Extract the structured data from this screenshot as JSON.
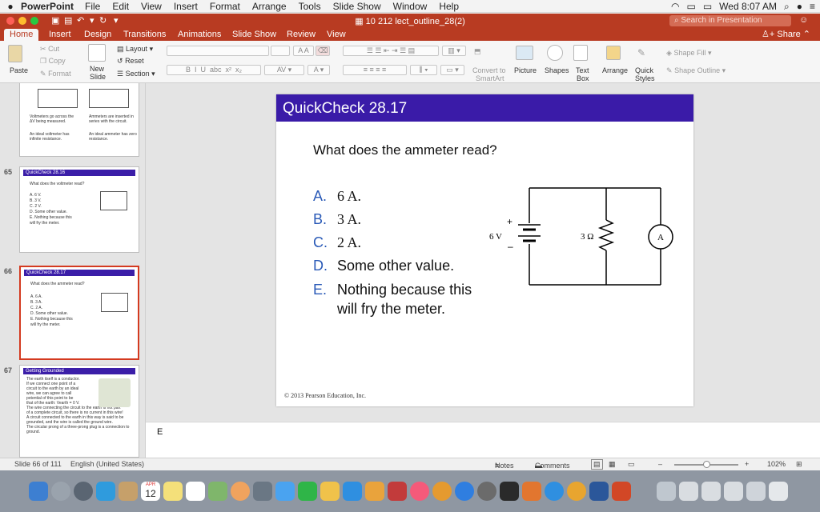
{
  "menubar": {
    "app_name": "PowerPoint",
    "items": [
      "File",
      "Edit",
      "View",
      "Insert",
      "Format",
      "Arrange",
      "Tools",
      "Slide Show",
      "Window",
      "Help"
    ],
    "clock": "Wed 8:07 AM"
  },
  "titlebar": {
    "doc_title": "10 212 lect_outline_28(2)",
    "search_placeholder": "Search in Presentation"
  },
  "ribbon_tabs": {
    "items": [
      "Home",
      "Insert",
      "Design",
      "Transitions",
      "Animations",
      "Slide Show",
      "Review",
      "View"
    ],
    "active": "Home",
    "share_label": "Share"
  },
  "ribbon": {
    "paste": "Paste",
    "cut": "Cut",
    "copy": "Copy",
    "format": "Format",
    "new_slide_1": "New",
    "new_slide_2": "Slide",
    "layout": "Layout",
    "reset": "Reset",
    "section": "Section",
    "convert_1": "Convert to",
    "convert_2": "SmartArt",
    "picture": "Picture",
    "shapes": "Shapes",
    "text_box_1": "Text",
    "text_box_2": "Box",
    "arrange": "Arrange",
    "quick_styles_1": "Quick",
    "quick_styles_2": "Styles",
    "shape_fill": "Shape Fill",
    "shape_outline": "Shape Outline"
  },
  "thumbnails": {
    "top_partial": {
      "bullet_a": "Voltmeters go across the ΔV being measured.",
      "bullet_b": "An ideal voltmeter has infinite resistance.",
      "bullet_c": "Ammeters are inserted in series with the circuit.",
      "bullet_d": "An ideal ammeter has zero resistance."
    },
    "slides": [
      {
        "number": "65",
        "title": "QuickCheck 28.16",
        "question": "What does the voltmeter read?",
        "answers": [
          "A.  6 V.",
          "B.  3 V.",
          "C.  2 V.",
          "D.  Some other value.",
          "E.  Nothing because this",
          "     will fry the meter."
        ]
      },
      {
        "number": "66",
        "title": "QuickCheck 28.17",
        "question": "What does the ammeter read?",
        "answers": [
          "A.  6 A.",
          "B.  3 A.",
          "C.  2 A.",
          "D.  Some other value.",
          "E.  Nothing because this",
          "     will fry the meter."
        ]
      },
      {
        "number": "67",
        "title": "Getting Grounded",
        "bullets": [
          "The earth itself is a conductor.",
          "If we connect one point of a",
          "circuit to the earth by an ideal",
          "wire, we can agree to call",
          "potential of this point to be",
          "that of the earth: Vearth = 0 V.",
          "The wire connecting the circuit to the earth is not part",
          "of a complete circuit, so there is no current in this wire!",
          "A circuit connected to the earth in this way is said to be",
          "grounded, and the wire is called the ground wire.",
          "The circular prong of a three-prong plug is a connection to",
          "ground."
        ]
      }
    ]
  },
  "slide": {
    "title": "QuickCheck 28.17",
    "question": "What does the ammeter read?",
    "answers": [
      {
        "letter": "A.",
        "text": "6 A."
      },
      {
        "letter": "B.",
        "text": "3 A."
      },
      {
        "letter": "C.",
        "text": "2 A."
      },
      {
        "letter": "D.",
        "text": "Some other value."
      },
      {
        "letter": "E.",
        "text": "Nothing because this"
      }
    ],
    "answer_e_line2": "will fry the meter.",
    "circuit": {
      "battery_label": "6 V",
      "plus": "+",
      "minus": "–",
      "resistor_label": "3 Ω",
      "meter_label": "A"
    },
    "copyright": "© 2013 Pearson Education, Inc."
  },
  "notes": {
    "text": "E"
  },
  "statusbar": {
    "slide_indicator": "Slide 66 of 111",
    "language": "English (United States)",
    "notes_label": "Notes",
    "comments_label": "Comments",
    "zoom_minus": "–",
    "zoom_plus": "+",
    "zoom_level": "102%",
    "zoom_fraction": 0.5
  },
  "dock": {
    "calendar_month": "APR",
    "calendar_day": "12"
  },
  "colors": {
    "ribbon_red": "#b83b22",
    "slide_title_purple": "#3a1ba8",
    "answer_letter_blue": "#2a5ab7",
    "selected_thumb_border": "#d43a20"
  }
}
